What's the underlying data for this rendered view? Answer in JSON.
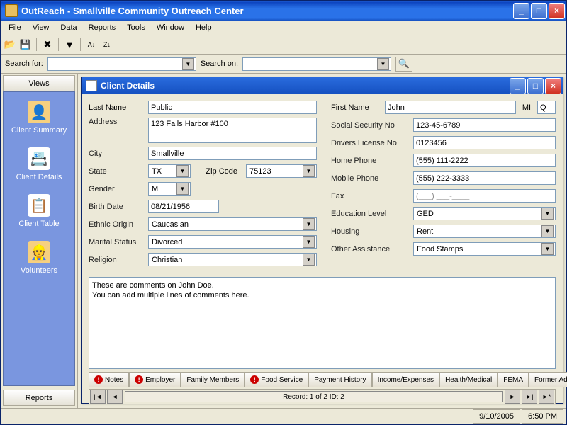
{
  "window": {
    "title": "OutReach - Smallville Community Outreach Center"
  },
  "menu": {
    "file": "File",
    "view": "View",
    "data": "Data",
    "reports": "Reports",
    "tools": "Tools",
    "window": "Window",
    "help": "Help"
  },
  "search": {
    "for_label": "Search for:",
    "on_label": "Search on:"
  },
  "sidebar": {
    "views_tab": "Views",
    "reports_tab": "Reports",
    "items": [
      {
        "label": "Client Summary"
      },
      {
        "label": "Client Details"
      },
      {
        "label": "Client Table"
      },
      {
        "label": "Volunteers"
      }
    ]
  },
  "child": {
    "title": "Client Details"
  },
  "form": {
    "last_name": {
      "label": "Last Name",
      "value": "Public"
    },
    "first_name": {
      "label": "First Name",
      "value": "John"
    },
    "mi": {
      "label": "MI",
      "value": "Q"
    },
    "address": {
      "label": "Address",
      "value": "123 Falls Harbor #100"
    },
    "city": {
      "label": "City",
      "value": "Smallville"
    },
    "state": {
      "label": "State",
      "value": "TX"
    },
    "zip": {
      "label": "Zip Code",
      "value": "75123"
    },
    "gender": {
      "label": "Gender",
      "value": "M"
    },
    "birth": {
      "label": "Birth Date",
      "value": "08/21/1956"
    },
    "ethnic": {
      "label": "Ethnic Origin",
      "value": "Caucasian"
    },
    "marital": {
      "label": "Marital Status",
      "value": "Divorced"
    },
    "religion": {
      "label": "Religion",
      "value": "Christian"
    },
    "ssn": {
      "label": "Social Security No",
      "value": "123-45-6789"
    },
    "dl": {
      "label": "Drivers License No",
      "value": "0123456"
    },
    "home": {
      "label": "Home Phone",
      "value": "(555) 111-2222"
    },
    "mobile": {
      "label": "Mobile Phone",
      "value": "(555) 222-3333"
    },
    "fax": {
      "label": "Fax",
      "value": "(___) ___-____"
    },
    "edu": {
      "label": "Education Level",
      "value": "GED"
    },
    "housing": {
      "label": "Housing",
      "value": "Rent"
    },
    "assist": {
      "label": "Other Assistance",
      "value": "Food Stamps"
    },
    "comments": "These are comments on John Doe.\nYou can add multiple lines of comments here."
  },
  "tabs": {
    "notes": "Notes",
    "employer": "Employer",
    "family": "Family Members",
    "food": "Food Service",
    "payment": "Payment History",
    "income": "Income/Expenses",
    "health": "Health/Medical",
    "fema": "FEMA",
    "former": "Former Address"
  },
  "nav": {
    "record": "Record: 1 of 2    ID: 2"
  },
  "status": {
    "date": "9/10/2005",
    "time": "6:50 PM"
  }
}
